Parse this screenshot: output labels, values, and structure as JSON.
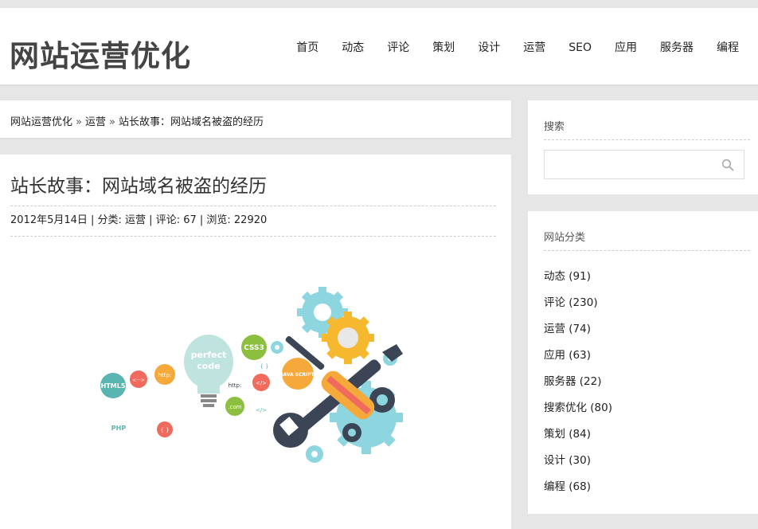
{
  "header": {
    "site_title": "网站运营优化",
    "nav": [
      "首页",
      "动态",
      "评论",
      "策划",
      "设计",
      "运营",
      "SEO",
      "应用",
      "服务器",
      "编程"
    ]
  },
  "breadcrumb": {
    "home": "网站运营优化",
    "sep": "»",
    "category": "运营",
    "current": "站长故事：网站域名被盗的经历"
  },
  "post": {
    "title": "站长故事：网站域名被盗的经历",
    "meta": "2012年5月14日 | 分类: 运营 | 评论: 67 | 浏览: 22920",
    "image_labels": {
      "html5": "HTML5",
      "php": "PHP",
      "bulb_line1": "perfect",
      "bulb_line2": "code",
      "css3": "CSS3",
      "http1": "http:",
      "http2": "http:",
      "com": ".com",
      "js": "JAVA SCRIPT",
      "tag_arrows": "<···>",
      "tag_braces": "{ }",
      "tag_code": "</>",
      "tag_code2": "</>",
      "tag_braces2": "{ }"
    }
  },
  "sidebar": {
    "search_title": "搜索",
    "search_placeholder": "",
    "categories_title": "网站分类",
    "categories": [
      "动态 (91)",
      "评论 (230)",
      "运营 (74)",
      "应用 (63)",
      "服务器 (22)",
      "搜索优化 (80)",
      "策划 (84)",
      "设计 (30)",
      "编程 (68)"
    ]
  },
  "colors": {
    "page_bg": "#e6e6e6",
    "panel_bg": "#ffffff",
    "teal": "#5ab5b0",
    "coral": "#f06b5d",
    "orange": "#f5a93b",
    "green": "#8cbf3f",
    "navy": "#3b4556",
    "light_blue": "#8dd6e0"
  }
}
